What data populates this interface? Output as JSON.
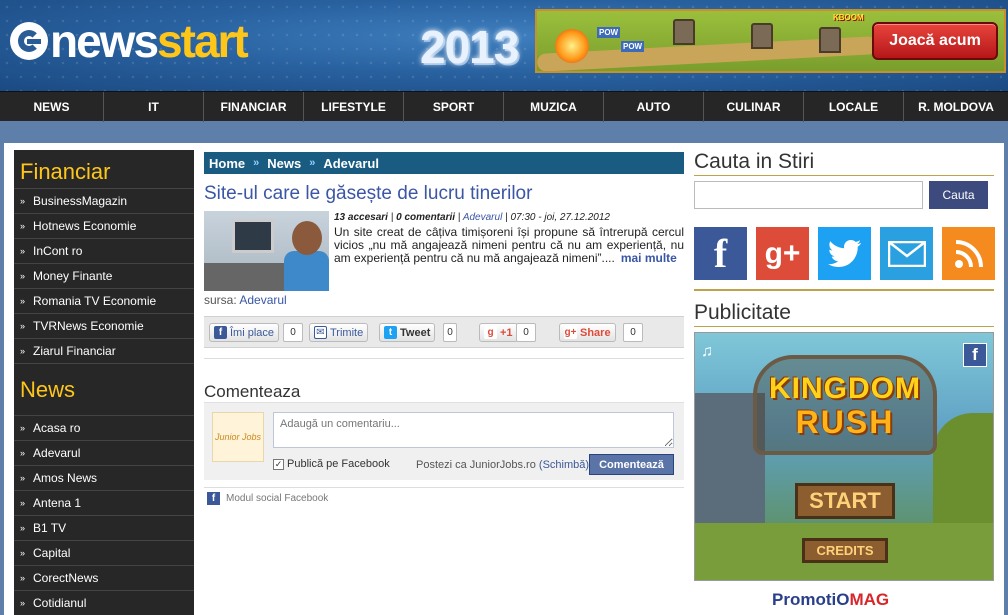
{
  "header": {
    "logo_news": "news",
    "logo_start": "start",
    "year": "2013",
    "banner_button": "Joacă acum",
    "banner_pow1": "POW",
    "banner_pow2": "POW",
    "banner_kboom": "KBOOM"
  },
  "nav": [
    "NEWS",
    "IT",
    "FINANCIAR",
    "LIFESTYLE",
    "SPORT",
    "MUZICA",
    "AUTO",
    "CULINAR",
    "LOCALE",
    "R. MOLDOVA"
  ],
  "sidebar": {
    "financiar_title": "Financiar",
    "financiar_items": [
      "BusinessMagazin",
      "Hotnews Economie",
      "InCont ro",
      "Money Finante",
      "Romania TV Economie",
      "TVRNews Economie",
      "Ziarul Financiar"
    ],
    "news_title": "News",
    "news_items": [
      "Acasa ro",
      "Adevarul",
      "Amos News",
      "Antena 1",
      "B1 TV",
      "Capital",
      "CorectNews",
      "Cotidianul"
    ]
  },
  "breadcrumb": [
    "Home",
    "News",
    "Adevarul"
  ],
  "article": {
    "title": "Site-ul care le găsește de lucru tinerilor",
    "accesari": "13 accesari",
    "comentarii": "0 comentarii",
    "source_link": "Adevarul",
    "datetime": "07:30 - joi, 27.12.2012",
    "description": "Un site creat de câțiva timișoreni își propune să întrerupă cercul vicios „nu mă angajează nimeni pentru că nu am experiență, nu am experiență pentru că nu mă angajează nimeni”....",
    "more": "mai multe",
    "sursa_label": "sursa:",
    "sursa_value": "Adevarul"
  },
  "social": {
    "like_label": "Îmi place",
    "like_count": "0",
    "send_label": "Trimite",
    "tweet_label": "Tweet",
    "tweet_count": "0",
    "gplus_label": "+1",
    "gplus_count": "0",
    "share_label": "Share",
    "share_count": "0"
  },
  "comments": {
    "title": "Comenteaza",
    "avatar_text": "Junior Jobs",
    "placeholder": "Adaugă un comentariu...",
    "fb_check_label": "Publică pe Facebook",
    "post_as": "Postezi ca JuniorJobs.ro",
    "switch": "(Schimbă)",
    "submit": "Comentează",
    "plugin": "Modul social Facebook"
  },
  "right": {
    "search_title": "Cauta in Stiri",
    "search_button": "Cauta",
    "icons": [
      "facebook-icon",
      "google-plus-icon",
      "twitter-icon",
      "email-icon",
      "rss-icon"
    ],
    "ad_title": "Publicitate",
    "ad_line1": "KINGDOM",
    "ad_line2": "RUSH",
    "ad_start": "START",
    "ad_credits": "CREDITS",
    "promo_a": "PromotiO",
    "promo_b": "MAG"
  },
  "colors": {
    "accent_yellow": "#ffc61a",
    "nav_bg": "#262626",
    "breadcrumb_bg": "#1a5b82",
    "link": "#3a56a5",
    "facebook": "#3b5998",
    "google": "#dd4b39",
    "twitter": "#1da1f2",
    "email": "#2aa0e0",
    "rss": "#f58a1f"
  }
}
